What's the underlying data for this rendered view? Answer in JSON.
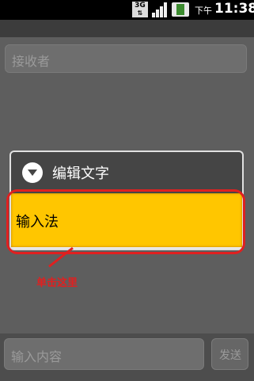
{
  "status_bar": {
    "network_label": "3G",
    "ampm": "下午",
    "time": "11:38",
    "icons": [
      "3g-icon",
      "signal-icon",
      "battery-charging-icon"
    ]
  },
  "compose": {
    "recipient_placeholder": "接收者",
    "message_placeholder": "输入内容",
    "send_label": "发送"
  },
  "context_menu": {
    "title": "编辑文字",
    "items": [
      {
        "label": "输入法",
        "highlighted": true
      }
    ]
  },
  "annotation": {
    "text": "单击这里",
    "color": "#e02020"
  },
  "colors": {
    "highlight_item": "#ffc600",
    "annotation_red": "#e02020"
  }
}
